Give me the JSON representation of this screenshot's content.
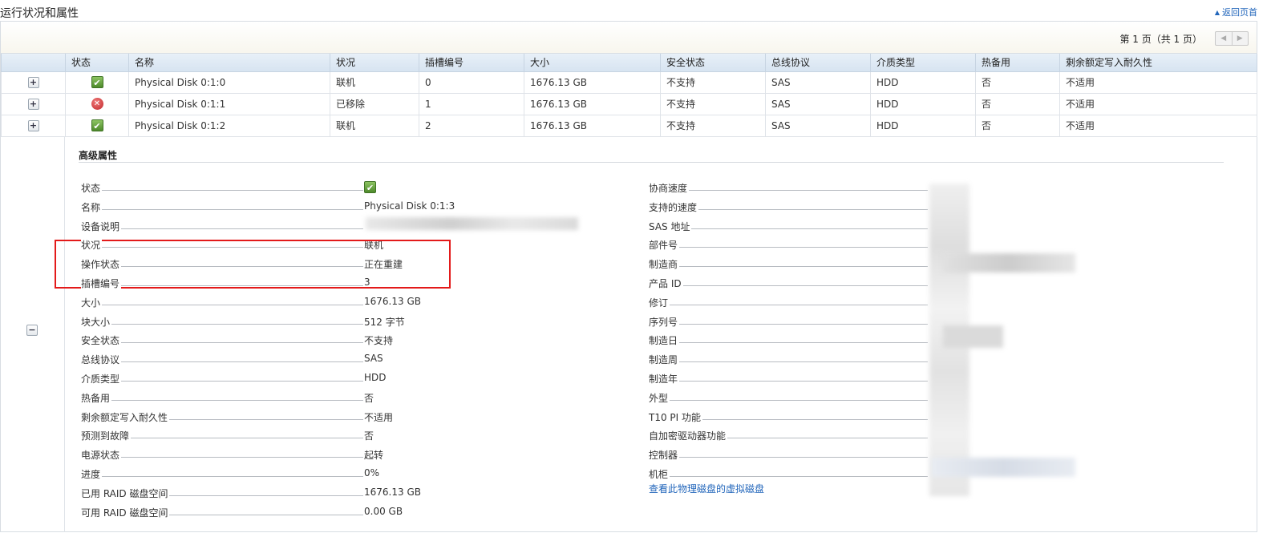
{
  "page_title": "运行状况和属性",
  "back_link": "返回页首",
  "pager": {
    "text": "第 1 页（共 1 页）",
    "prev": "◀",
    "next": "▶"
  },
  "table": {
    "headers": [
      "状态",
      "名称",
      "状况",
      "插槽编号",
      "大小",
      "安全状态",
      "总线协议",
      "介质类型",
      "热备用",
      "剩余额定写入耐久性"
    ],
    "rows": [
      {
        "expand": "+",
        "status": "ok",
        "name": "Physical Disk 0:1:0",
        "state": "联机",
        "slot": "0",
        "size": "1676.13 GB",
        "security": "不支持",
        "bus": "SAS",
        "media": "HDD",
        "hotspare": "否",
        "endurance": "不适用"
      },
      {
        "expand": "+",
        "status": "error",
        "name": "Physical Disk 0:1:1",
        "state": "已移除",
        "slot": "1",
        "size": "1676.13 GB",
        "security": "不支持",
        "bus": "SAS",
        "media": "HDD",
        "hotspare": "否",
        "endurance": "不适用"
      },
      {
        "expand": "+",
        "status": "ok",
        "name": "Physical Disk 0:1:2",
        "state": "联机",
        "slot": "2",
        "size": "1676.13 GB",
        "security": "不支持",
        "bus": "SAS",
        "media": "HDD",
        "hotspare": "否",
        "endurance": "不适用"
      }
    ]
  },
  "detail": {
    "collapse": "−",
    "title": "高级属性",
    "left": [
      {
        "label": "状态",
        "value": "",
        "icon": "ok"
      },
      {
        "label": "名称",
        "value": "Physical Disk 0:1:3"
      },
      {
        "label": "设备说明",
        "value": ""
      },
      {
        "label": "状况",
        "value": "联机"
      },
      {
        "label": "操作状态",
        "value": "正在重建"
      },
      {
        "label": "插槽编号",
        "value": "3"
      },
      {
        "label": "大小",
        "value": "1676.13 GB"
      },
      {
        "label": "块大小",
        "value": "512 字节"
      },
      {
        "label": "安全状态",
        "value": "不支持"
      },
      {
        "label": "总线协议",
        "value": "SAS"
      },
      {
        "label": "介质类型",
        "value": "HDD"
      },
      {
        "label": "热备用",
        "value": "否"
      },
      {
        "label": "剩余额定写入耐久性",
        "value": "不适用"
      },
      {
        "label": "预测到故障",
        "value": "否"
      },
      {
        "label": "电源状态",
        "value": "起转"
      },
      {
        "label": "进度",
        "value": "0%"
      },
      {
        "label": "已用 RAID 磁盘空间",
        "value": "1676.13 GB"
      },
      {
        "label": "可用 RAID 磁盘空间",
        "value": "0.00 GB"
      }
    ],
    "right": [
      {
        "label": "协商速度",
        "value": ""
      },
      {
        "label": "支持的速度",
        "value": ""
      },
      {
        "label": "SAS 地址",
        "value": ""
      },
      {
        "label": "部件号",
        "value": ""
      },
      {
        "label": "制造商",
        "value": ""
      },
      {
        "label": "产品 ID",
        "value": ""
      },
      {
        "label": "修订",
        "value": ""
      },
      {
        "label": "序列号",
        "value": ""
      },
      {
        "label": "制造日",
        "value": ""
      },
      {
        "label": "制造周",
        "value": ""
      },
      {
        "label": "制造年",
        "value": ""
      },
      {
        "label": "外型",
        "value": ""
      },
      {
        "label": "T10 PI 功能",
        "value": ""
      },
      {
        "label": "自加密驱动器功能",
        "value": ""
      },
      {
        "label": "控制器",
        "value": ""
      },
      {
        "label": "机柜",
        "value": ""
      }
    ],
    "link": "查看此物理磁盘的虚拟磁盘"
  }
}
